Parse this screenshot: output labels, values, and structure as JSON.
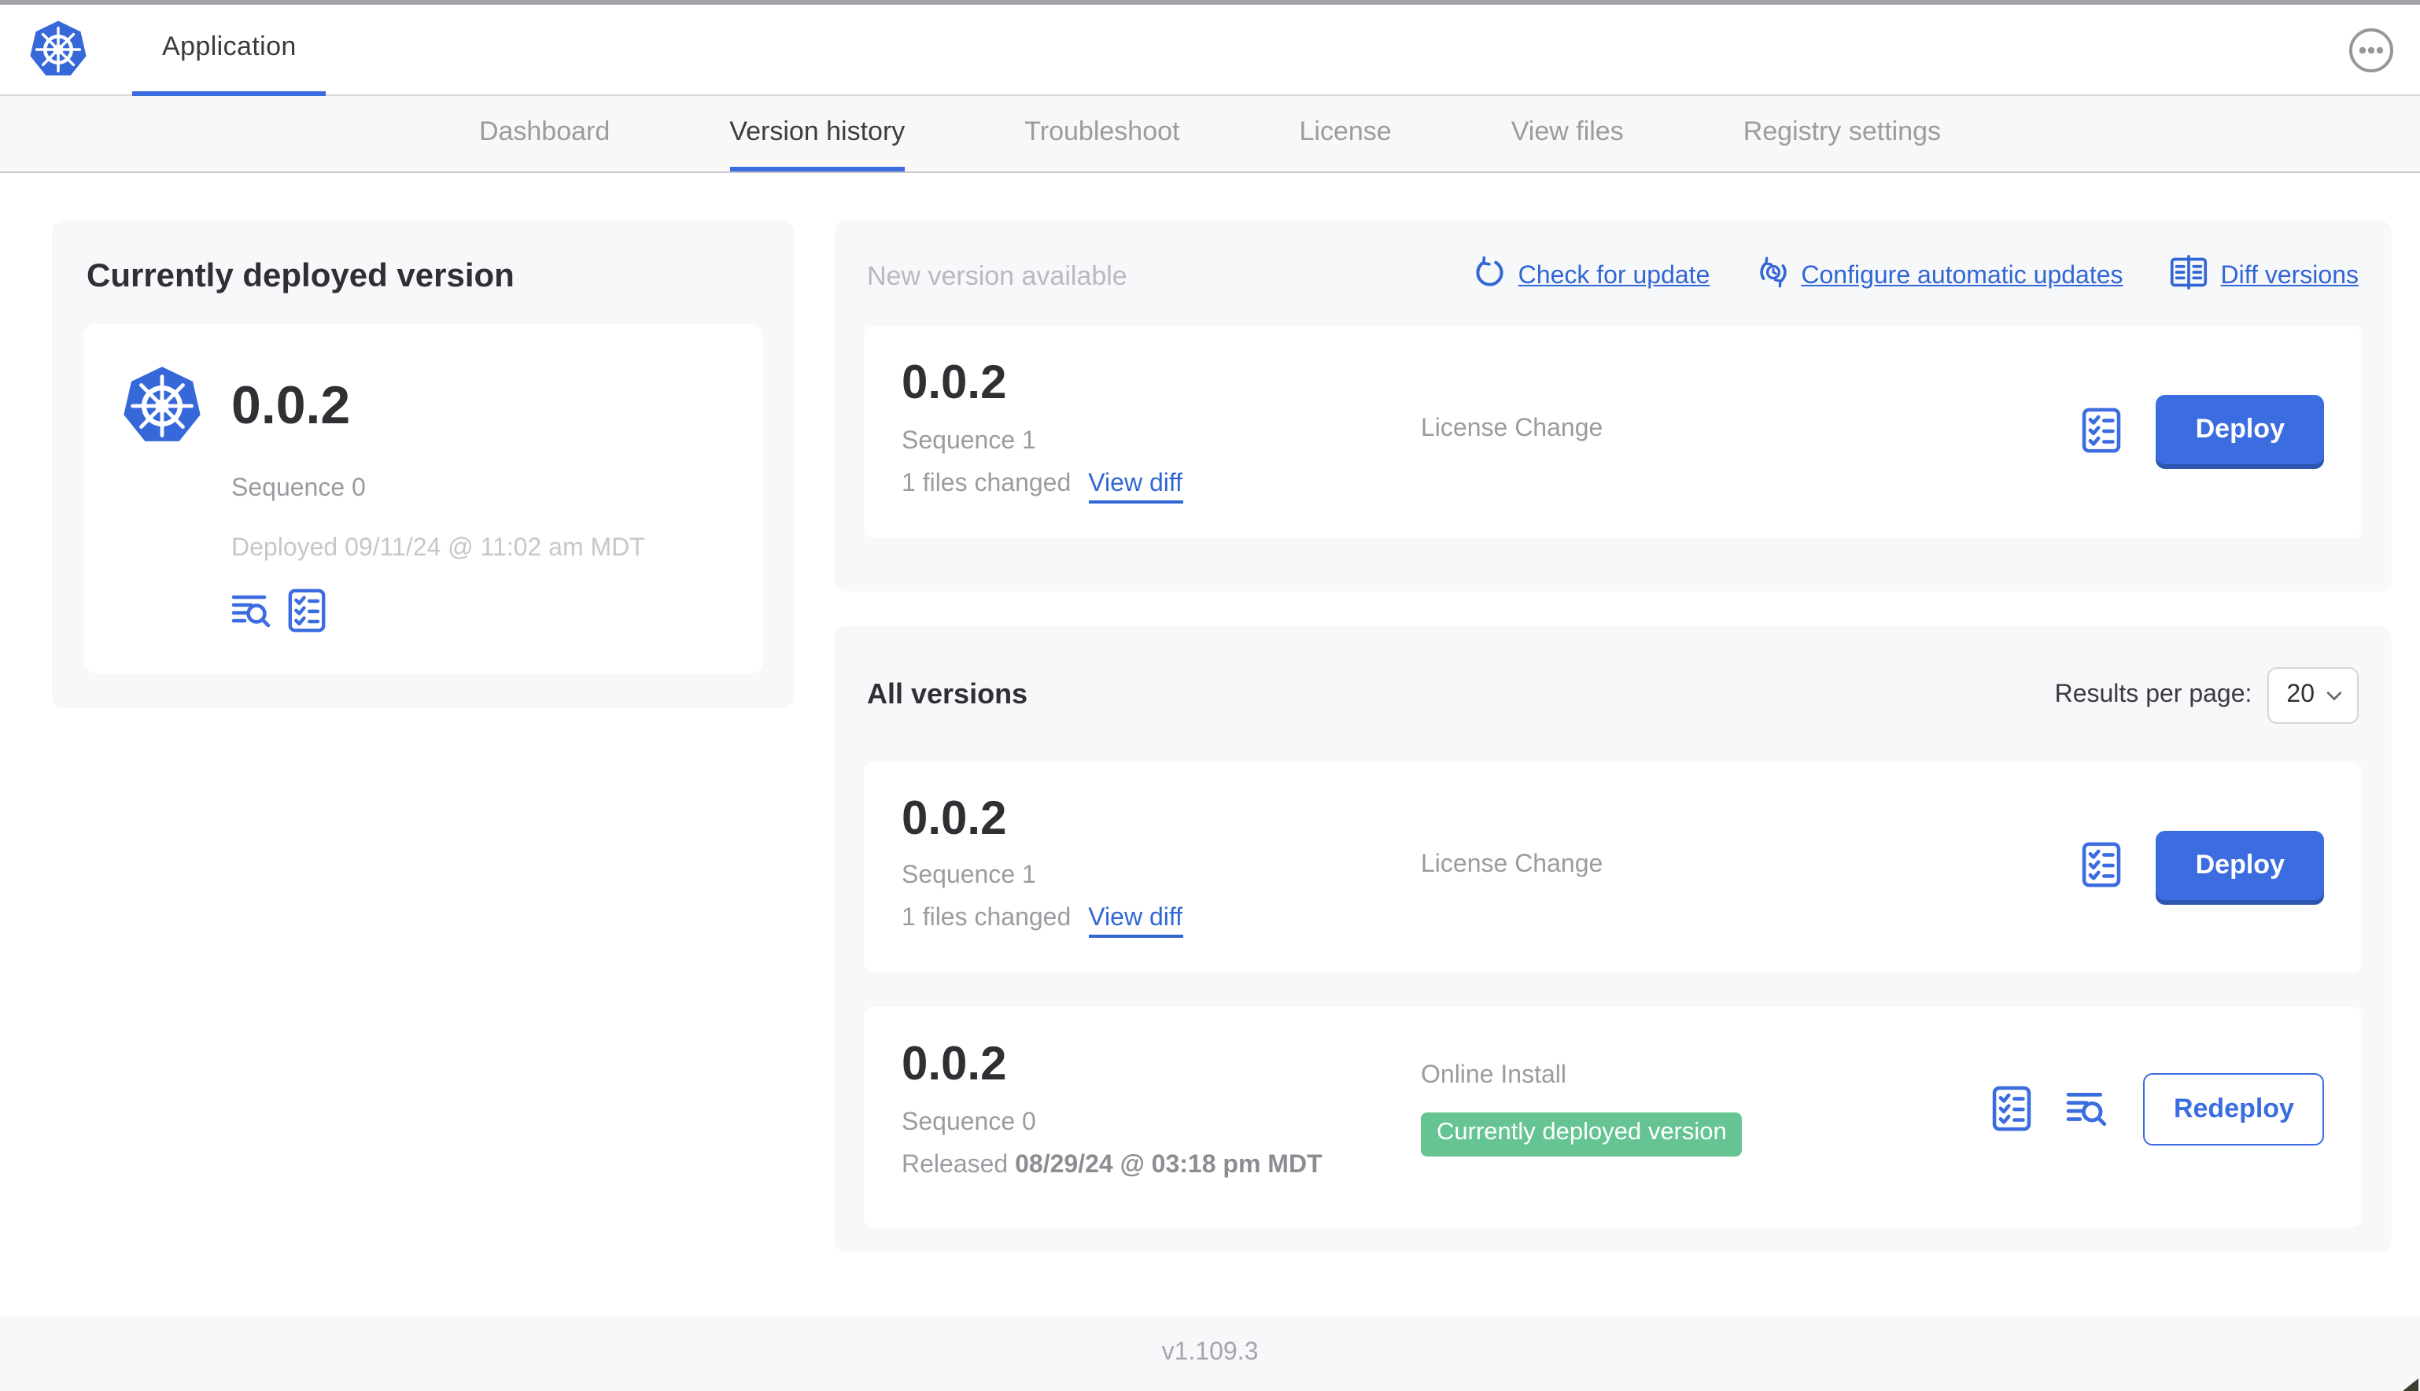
{
  "header": {
    "app_tab_label": "Application"
  },
  "nav_tabs": [
    {
      "label": "Dashboard",
      "active": false
    },
    {
      "label": "Version history",
      "active": true
    },
    {
      "label": "Troubleshoot",
      "active": false
    },
    {
      "label": "License",
      "active": false
    },
    {
      "label": "View files",
      "active": false
    },
    {
      "label": "Registry settings",
      "active": false
    }
  ],
  "current_version": {
    "title": "Currently deployed version",
    "version": "0.0.2",
    "sequence": "Sequence 0",
    "deployed": "Deployed 09/11/24 @ 11:02 am MDT"
  },
  "new_version": {
    "title": "New version available",
    "actions": [
      {
        "label": "Check for update",
        "icon": "refresh-icon"
      },
      {
        "label": "Configure automatic updates",
        "icon": "auto-update-icon"
      },
      {
        "label": "Diff versions",
        "icon": "diff-icon"
      }
    ],
    "row": {
      "version": "0.0.2",
      "sequence": "Sequence 1",
      "changes": "1 files changed",
      "view_diff_label": "View diff",
      "source": "License Change",
      "deploy_label": "Deploy"
    }
  },
  "all_versions": {
    "title": "All versions",
    "results_per_page_label": "Results per page:",
    "results_per_page_value": "20",
    "rows": [
      {
        "version": "0.0.2",
        "sequence": "Sequence 1",
        "changes": "1 files changed",
        "view_diff_label": "View diff",
        "source": "License Change",
        "deploy_label": "Deploy"
      },
      {
        "version": "0.0.2",
        "sequence": "Sequence 0",
        "released_prefix": "Released",
        "released_date": "08/29/24 @ 03:18 pm MDT",
        "source": "Online Install",
        "badge": "Currently deployed version",
        "redeploy_label": "Redeploy"
      }
    ]
  },
  "footer": {
    "app_version": "v1.109.3"
  },
  "colors": {
    "accent_blue": "#3b6ce0",
    "link_blue": "#3166d4",
    "k8s_logo_blue": "#3668d9",
    "badge_green": "#65c492",
    "text_dark": "#2f2f34",
    "text_gray": "#9b9ba1",
    "text_light_gray": "#c6c6cc",
    "card_background": "#f7f8fa",
    "subnav_background": "#f8f8f9"
  }
}
